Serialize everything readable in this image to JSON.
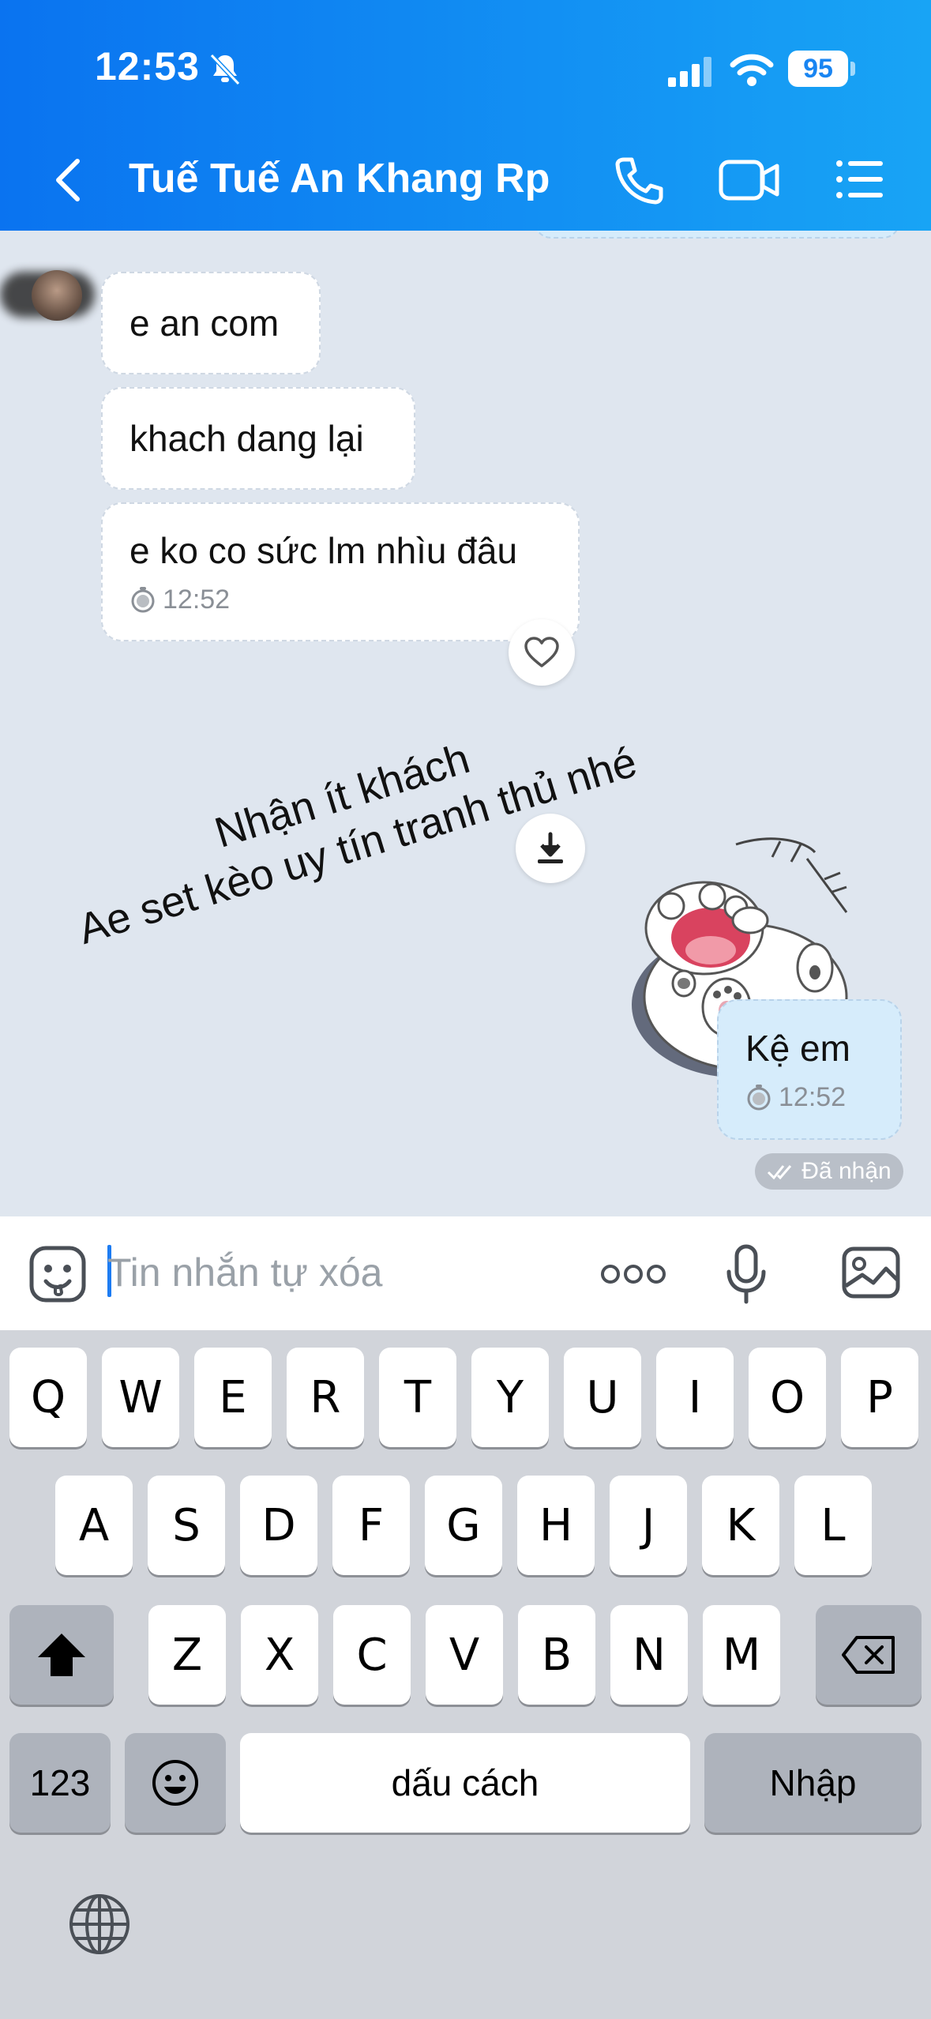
{
  "status_bar": {
    "time": "12:53",
    "battery": "95"
  },
  "header": {
    "title": "Tuế Tuế An Khang Rp"
  },
  "messages": {
    "m1": "e an com",
    "m2": "khach dang lại",
    "m3": "e ko co sức lm nhìu đâu",
    "m3_time": "12:52",
    "sticker_line1": "Nhận ít khách",
    "sticker_line2": "Ae set kèo uy tín tranh thủ nhé",
    "m4": "Kệ em",
    "m4_time": "12:52",
    "receipt": "Đã nhận"
  },
  "input": {
    "placeholder": "Tin nhắn tự xóa"
  },
  "keyboard": {
    "row1": [
      "Q",
      "W",
      "E",
      "R",
      "T",
      "Y",
      "U",
      "I",
      "O",
      "P"
    ],
    "row2": [
      "A",
      "S",
      "D",
      "F",
      "G",
      "H",
      "J",
      "K",
      "L"
    ],
    "row3": [
      "Z",
      "X",
      "C",
      "V",
      "B",
      "N",
      "M"
    ],
    "numbers": "123",
    "space": "dấu cách",
    "return": "Nhập"
  }
}
